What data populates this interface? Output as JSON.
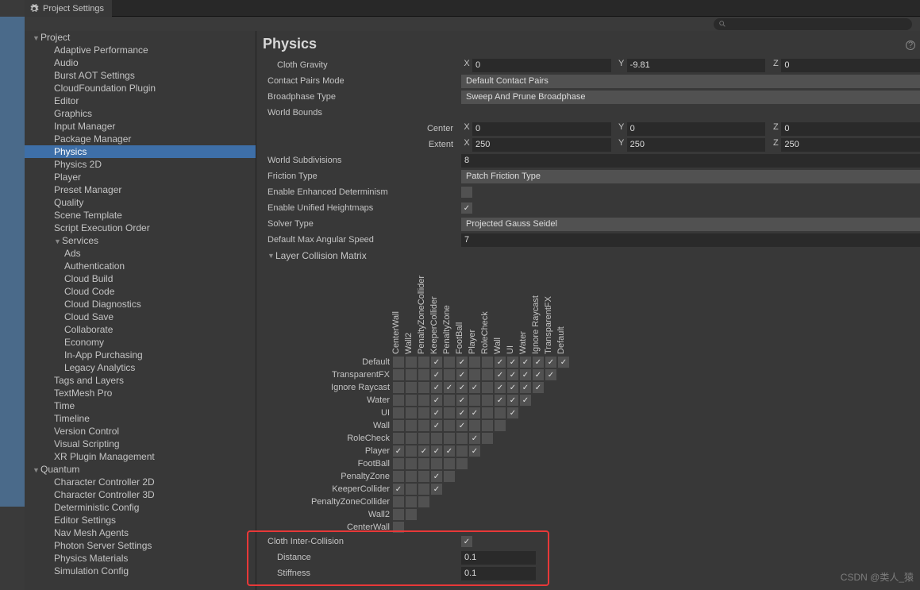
{
  "tab": {
    "title": "Project Settings"
  },
  "search": {
    "placeholder": ""
  },
  "sidebar": {
    "items": [
      {
        "label": "Project",
        "depth": 0,
        "expanded": true
      },
      {
        "label": "Adaptive Performance",
        "depth": 1
      },
      {
        "label": "Audio",
        "depth": 1
      },
      {
        "label": "Burst AOT Settings",
        "depth": 1
      },
      {
        "label": "CloudFoundation Plugin",
        "depth": 1
      },
      {
        "label": "Editor",
        "depth": 1
      },
      {
        "label": "Graphics",
        "depth": 1
      },
      {
        "label": "Input Manager",
        "depth": 1
      },
      {
        "label": "Package Manager",
        "depth": 1
      },
      {
        "label": "Physics",
        "depth": 1,
        "selected": true
      },
      {
        "label": "Physics 2D",
        "depth": 1
      },
      {
        "label": "Player",
        "depth": 1
      },
      {
        "label": "Preset Manager",
        "depth": 1
      },
      {
        "label": "Quality",
        "depth": 1
      },
      {
        "label": "Scene Template",
        "depth": 1
      },
      {
        "label": "Script Execution Order",
        "depth": 1
      },
      {
        "label": "Services",
        "depth": 1,
        "expanded": true
      },
      {
        "label": "Ads",
        "depth": 2
      },
      {
        "label": "Authentication",
        "depth": 2
      },
      {
        "label": "Cloud Build",
        "depth": 2
      },
      {
        "label": "Cloud Code",
        "depth": 2
      },
      {
        "label": "Cloud Diagnostics",
        "depth": 2
      },
      {
        "label": "Cloud Save",
        "depth": 2
      },
      {
        "label": "Collaborate",
        "depth": 2
      },
      {
        "label": "Economy",
        "depth": 2
      },
      {
        "label": "In-App Purchasing",
        "depth": 2
      },
      {
        "label": "Legacy Analytics",
        "depth": 2
      },
      {
        "label": "Tags and Layers",
        "depth": 1
      },
      {
        "label": "TextMesh Pro",
        "depth": 1
      },
      {
        "label": "Time",
        "depth": 1
      },
      {
        "label": "Timeline",
        "depth": 1
      },
      {
        "label": "Version Control",
        "depth": 1
      },
      {
        "label": "Visual Scripting",
        "depth": 1
      },
      {
        "label": "XR Plugin Management",
        "depth": 1
      },
      {
        "label": "Quantum",
        "depth": 0,
        "expanded": true
      },
      {
        "label": "Character Controller 2D",
        "depth": 1
      },
      {
        "label": "Character Controller 3D",
        "depth": 1
      },
      {
        "label": "Deterministic Config",
        "depth": 1
      },
      {
        "label": "Editor Settings",
        "depth": 1
      },
      {
        "label": "Nav Mesh Agents",
        "depth": 1
      },
      {
        "label": "Photon Server Settings",
        "depth": 1
      },
      {
        "label": "Physics Materials",
        "depth": 1
      },
      {
        "label": "Simulation Config",
        "depth": 1
      }
    ]
  },
  "main": {
    "title": "Physics",
    "labels": {
      "cloth_gravity": "Cloth Gravity",
      "contact_pairs": "Contact Pairs Mode",
      "broadphase": "Broadphase Type",
      "world_bounds": "World Bounds",
      "center": "Center",
      "extent": "Extent",
      "world_subdiv": "World Subdivisions",
      "friction": "Friction Type",
      "enhanced": "Enable Enhanced Determinism",
      "unified": "Enable Unified Heightmaps",
      "solver": "Solver Type",
      "max_angular": "Default Max Angular Speed",
      "layer_matrix": "Layer Collision Matrix",
      "cloth_inter": "Cloth Inter-Collision",
      "distance": "Distance",
      "stiffness": "Stiffness",
      "x": "X",
      "y": "Y",
      "z": "Z"
    },
    "values": {
      "cloth_gravity": {
        "x": "0",
        "y": "-9.81",
        "z": "0"
      },
      "contact_pairs": "Default Contact Pairs",
      "broadphase": "Sweep And Prune Broadphase",
      "center": {
        "x": "0",
        "y": "0",
        "z": "0"
      },
      "extent": {
        "x": "250",
        "y": "250",
        "z": "250"
      },
      "world_subdiv": "8",
      "friction": "Patch Friction Type",
      "enhanced": false,
      "unified": true,
      "solver": "Projected Gauss Seidel",
      "max_angular": "7",
      "cloth_inter": true,
      "distance": "0.1",
      "stiffness": "0.1"
    },
    "matrix": {
      "cols": [
        "CenterWall",
        "Wall2",
        "PenaltyZoneCollider",
        "KeeperCollider",
        "PenaltyZone",
        "FootBall",
        "Player",
        "RoleCheck",
        "Wall",
        "UI",
        "Water",
        "Ignore Raycast",
        "TransparentFX",
        "Default"
      ],
      "rows": [
        {
          "name": "Default",
          "cells": [
            0,
            0,
            0,
            1,
            0,
            1,
            0,
            0,
            1,
            1,
            1,
            1,
            1,
            1
          ]
        },
        {
          "name": "TransparentFX",
          "cells": [
            0,
            0,
            0,
            1,
            0,
            1,
            0,
            0,
            1,
            1,
            1,
            1,
            1
          ]
        },
        {
          "name": "Ignore Raycast",
          "cells": [
            0,
            0,
            0,
            1,
            1,
            1,
            1,
            0,
            1,
            1,
            1,
            1
          ]
        },
        {
          "name": "Water",
          "cells": [
            0,
            0,
            0,
            1,
            0,
            1,
            0,
            0,
            1,
            1,
            1
          ]
        },
        {
          "name": "UI",
          "cells": [
            0,
            0,
            0,
            1,
            0,
            1,
            1,
            0,
            0,
            1
          ]
        },
        {
          "name": "Wall",
          "cells": [
            0,
            0,
            0,
            1,
            0,
            1,
            0,
            0,
            0
          ]
        },
        {
          "name": "RoleCheck",
          "cells": [
            0,
            0,
            0,
            0,
            0,
            0,
            1,
            0
          ]
        },
        {
          "name": "Player",
          "cells": [
            1,
            0,
            1,
            1,
            1,
            0,
            1
          ]
        },
        {
          "name": "FootBall",
          "cells": [
            0,
            0,
            0,
            0,
            0,
            0
          ]
        },
        {
          "name": "PenaltyZone",
          "cells": [
            0,
            0,
            0,
            1,
            0
          ]
        },
        {
          "name": "KeeperCollider",
          "cells": [
            1,
            0,
            0,
            1
          ]
        },
        {
          "name": "PenaltyZoneCollider",
          "cells": [
            0,
            0,
            0
          ]
        },
        {
          "name": "Wall2",
          "cells": [
            0,
            0
          ]
        },
        {
          "name": "CenterWall",
          "cells": [
            0
          ]
        }
      ]
    }
  },
  "watermark": "CSDN @类人_猿"
}
